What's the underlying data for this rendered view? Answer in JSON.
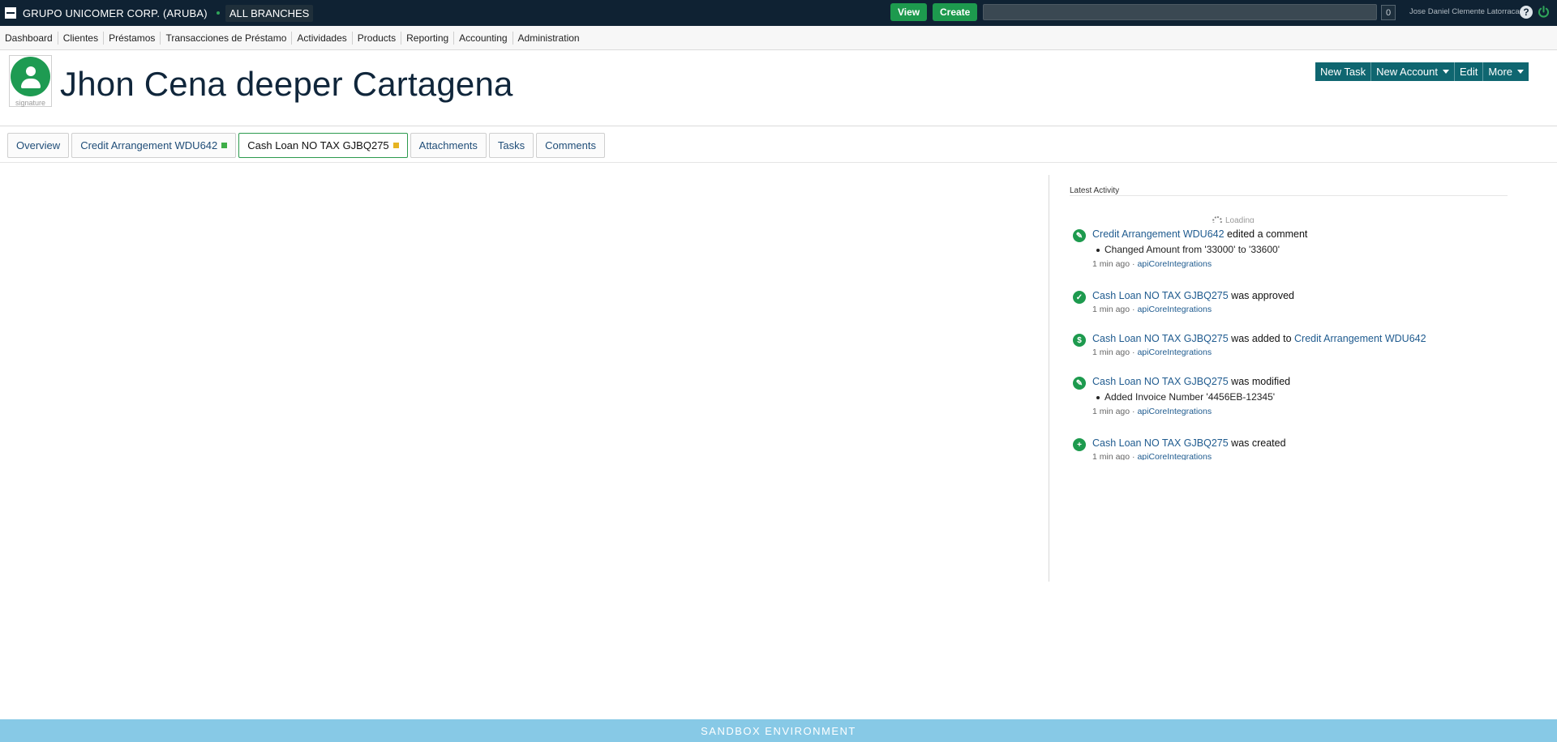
{
  "topbar": {
    "company": "GRUPO UNICOMER CORP. (ARUBA)",
    "branch": "ALL BRANCHES",
    "view_label": "View",
    "create_label": "Create",
    "count": "0",
    "username": "Jose Daniel Clemente Latorraca",
    "help_glyph": "?"
  },
  "menu": {
    "items": [
      "Dashboard",
      "Clientes",
      "Préstamos",
      "Transacciones de Préstamo",
      "Actividades",
      "Products",
      "Reporting",
      "Accounting",
      "Administration"
    ]
  },
  "header": {
    "avatar_label": "signature",
    "title": "Jhon Cena deeper Cartagena",
    "actions": {
      "new_task": "New Task",
      "new_account": "New Account",
      "edit": "Edit",
      "more": "More"
    }
  },
  "tabs": [
    {
      "label": "Overview"
    },
    {
      "label": "Credit Arrangement WDU642",
      "status_color": "#3fae49"
    },
    {
      "label": "Cash Loan NO TAX GJBQ275",
      "status_color": "#e6b422"
    },
    {
      "label": "Attachments"
    },
    {
      "label": "Tasks"
    },
    {
      "label": "Comments"
    }
  ],
  "activity": {
    "title": "Latest Activity",
    "loading": "Loading",
    "entries": [
      {
        "icon": "pencil-icon",
        "link": "Credit Arrangement WDU642",
        "text": " edited a comment",
        "detail": "Changed Amount from '33000' to '33600'",
        "time": "1 min ago · ",
        "user": "apiCoreIntegrations"
      },
      {
        "icon": "check-icon",
        "link": "Cash Loan NO TAX GJBQ275",
        "text": " was approved",
        "time": "1 min ago · ",
        "user": "apiCoreIntegrations"
      },
      {
        "icon": "dollar-icon",
        "link": "Cash Loan NO TAX GJBQ275",
        "text": " was added to ",
        "link2": "Credit Arrangement WDU642",
        "time": "1 min ago · ",
        "user": "apiCoreIntegrations"
      },
      {
        "icon": "pencil-icon",
        "link": "Cash Loan NO TAX GJBQ275",
        "text": " was modified",
        "detail": "Added Invoice Number '4456EB-12345'",
        "time": "1 min ago · ",
        "user": "apiCoreIntegrations"
      },
      {
        "icon": "plus-icon",
        "link": "Cash Loan NO TAX GJBQ275",
        "text": " was created",
        "time": "1 min ago · ",
        "user": "apiCoreIntegrations"
      }
    ]
  },
  "footer": {
    "text": "SANDBOX ENVIRONMENT"
  }
}
